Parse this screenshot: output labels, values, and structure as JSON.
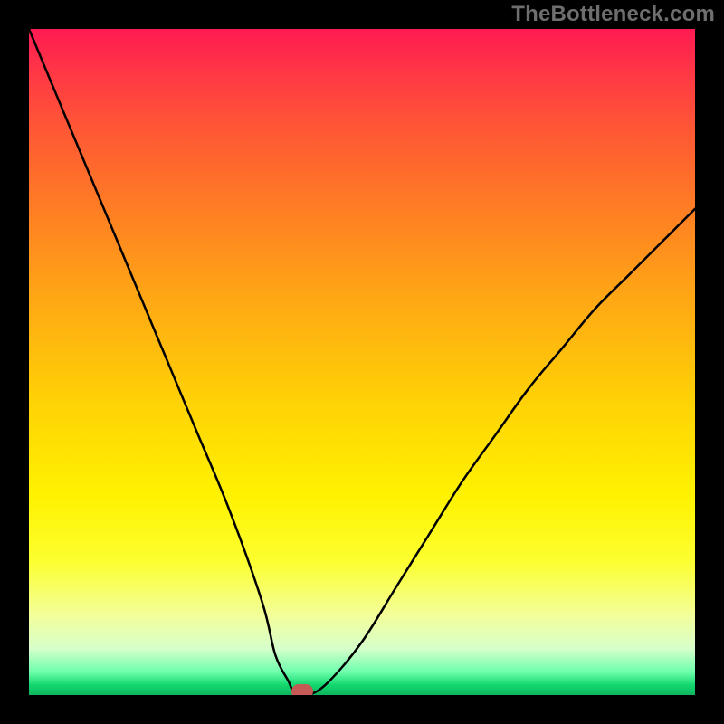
{
  "watermark": "TheBottleneck.com",
  "chart_data": {
    "type": "line",
    "title": "",
    "xlabel": "",
    "ylabel": "",
    "xlim": [
      0,
      100
    ],
    "ylim": [
      0,
      100
    ],
    "grid": false,
    "x": [
      0,
      5,
      10,
      15,
      20,
      25,
      30,
      35,
      37,
      39,
      40,
      42,
      45,
      50,
      55,
      60,
      65,
      70,
      75,
      80,
      85,
      90,
      95,
      100
    ],
    "y": [
      100,
      88,
      76,
      64,
      52,
      40,
      28,
      14,
      6,
      2,
      0,
      0,
      2,
      8,
      16,
      24,
      32,
      39,
      46,
      52,
      58,
      63,
      68,
      73
    ],
    "marker": {
      "x": 41,
      "y": 0,
      "color": "#c65a55"
    },
    "gradient_stops": [
      {
        "pos": 0.0,
        "color": "#ff1a52"
      },
      {
        "pos": 0.15,
        "color": "#ff5735"
      },
      {
        "pos": 0.4,
        "color": "#ffa615"
      },
      {
        "pos": 0.7,
        "color": "#fff200"
      },
      {
        "pos": 0.93,
        "color": "#d7ffcb"
      },
      {
        "pos": 1.0,
        "color": "#0db45e"
      }
    ]
  }
}
